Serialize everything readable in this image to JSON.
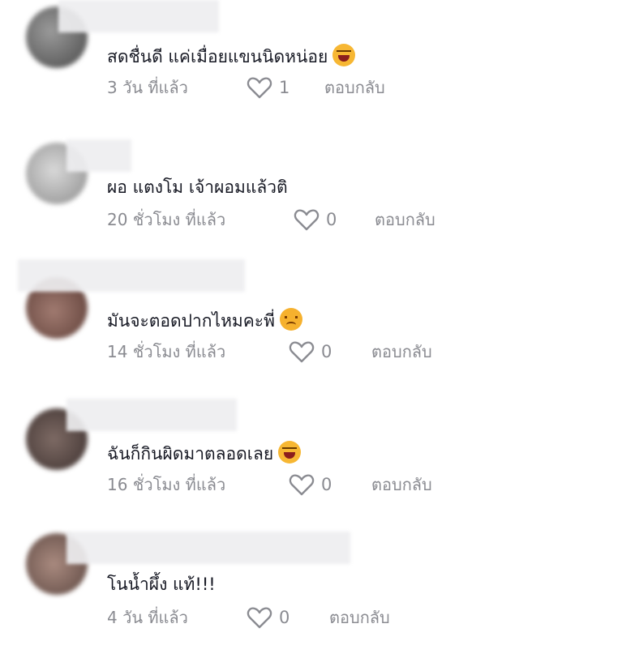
{
  "comments": [
    {
      "text": "สดชื่นดี แค่เมื่อยแขนนิดหน่อย",
      "emoji": "laughing-tears",
      "time": "3 วัน ที่แล้ว",
      "likes": "1",
      "reply": "ตอบกลับ"
    },
    {
      "text": "ผอ แตงโม เจ้าผอมแล้วติ",
      "emoji": "",
      "time": "20 ชั่วโมง ที่แล้ว",
      "likes": "0",
      "reply": "ตอบกลับ"
    },
    {
      "text": "มันจะตอดปากไหมคะพี่",
      "emoji": "disappointed-face",
      "time": "14 ชั่วโมง ที่แล้ว",
      "likes": "0",
      "reply": "ตอบกลับ"
    },
    {
      "text": "ฉันก็กินผิดมาตลอดเลย",
      "emoji": "laughing-tears",
      "time": "16 ชั่วโมง ที่แล้ว",
      "likes": "0",
      "reply": "ตอบกลับ"
    },
    {
      "text": "โนน้ำผึ้ง แท้!!!",
      "emoji": "",
      "time": "4 วัน ที่แล้ว",
      "likes": "0",
      "reply": "ตอบกลับ"
    }
  ],
  "colors": {
    "text": "#161823",
    "meta": "#8a8b91",
    "background": "#ffffff"
  }
}
